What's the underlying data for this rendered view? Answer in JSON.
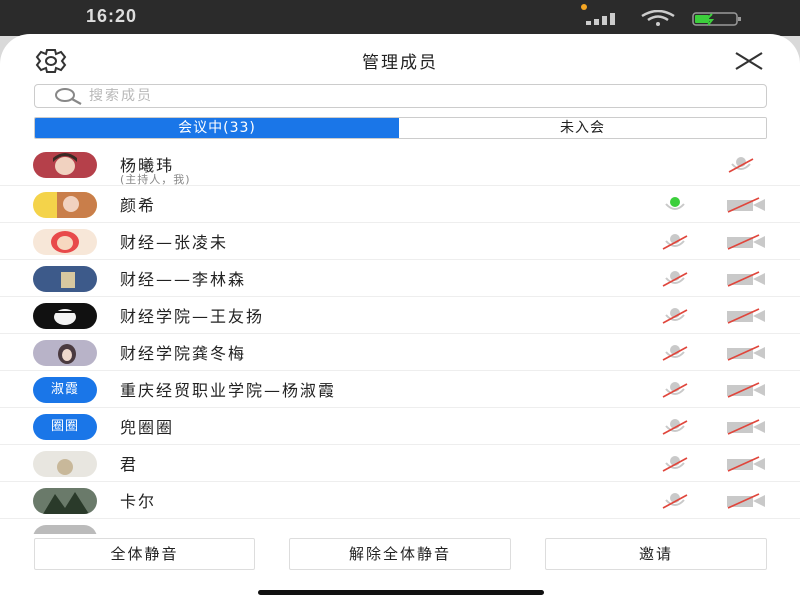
{
  "status": {
    "time": "16:20"
  },
  "header": {
    "title": "管理成员"
  },
  "search": {
    "placeholder": "搜索成员"
  },
  "tabs": [
    {
      "label": "会议中(33)",
      "active": true
    },
    {
      "label": "未入会",
      "active": false
    }
  ],
  "members": [
    {
      "name": "杨曦玮",
      "subtitle": "(主持人，我)",
      "avatar": "photo",
      "mic": "off",
      "camera": "off",
      "show_camera_only": true
    },
    {
      "name": "颜希",
      "avatar": "photo",
      "mic": "on",
      "camera": "off"
    },
    {
      "name": "财经—张凌未",
      "avatar": "photo",
      "mic": "off",
      "camera": "off"
    },
    {
      "name": "财经——李林森",
      "avatar": "photo",
      "mic": "off",
      "camera": "off"
    },
    {
      "name": "财经学院—王友扬",
      "avatar": "photo",
      "mic": "off",
      "camera": "off"
    },
    {
      "name": "财经学院龚冬梅",
      "avatar": "photo",
      "mic": "off",
      "camera": "off"
    },
    {
      "name": "重庆经贸职业学院—杨淑霞",
      "avatar_text": "淑霞",
      "mic": "off",
      "camera": "off"
    },
    {
      "name": "兜圈圈",
      "avatar_text": "圈圈",
      "mic": "off",
      "camera": "off"
    },
    {
      "name": "君",
      "avatar": "photo",
      "mic": "off",
      "camera": "off"
    },
    {
      "name": "卡尔",
      "avatar": "photo",
      "mic": "off",
      "camera": "off"
    }
  ],
  "footer": {
    "mute_all": "全体静音",
    "unmute_all": "解除全体静音",
    "invite": "邀请"
  },
  "colors": {
    "accent": "#1a76e8",
    "mic_on": "#3ccf3c",
    "muted_slash": "#e0463c"
  }
}
